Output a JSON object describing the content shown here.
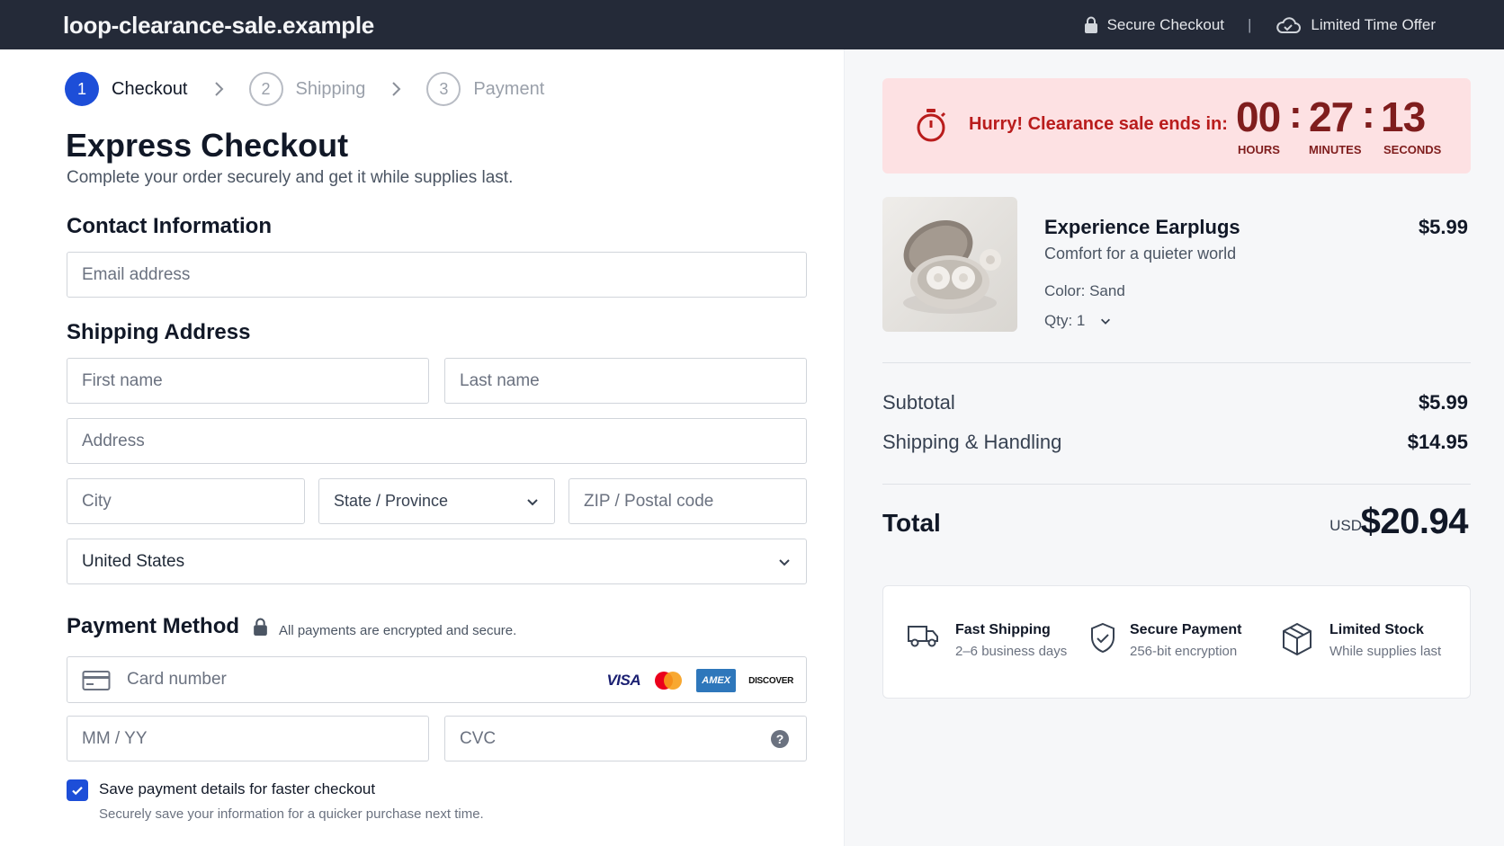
{
  "site_title": "loop-clearance-sale.example",
  "header": {
    "secure_checkout": "Secure Checkout",
    "separator": "|",
    "limited_offer": "Limited Time Offer"
  },
  "steps": [
    {
      "num": "1",
      "label": "Checkout"
    },
    {
      "num": "2",
      "label": "Shipping"
    },
    {
      "num": "3",
      "label": "Payment"
    }
  ],
  "page": {
    "title": "Express Checkout",
    "subtitle": "Complete your order securely and get it while supplies last."
  },
  "contact": {
    "heading": "Contact Information",
    "email_placeholder": "Email address"
  },
  "shipping": {
    "heading": "Shipping Address",
    "first_name": "First name",
    "last_name": "Last name",
    "address": "Address",
    "city": "City",
    "state": "State / Province",
    "zip": "ZIP / Postal code",
    "country": "United States"
  },
  "payment": {
    "heading": "Payment Method",
    "note": "All payments are encrypted and secure.",
    "card_number": "Card number",
    "card_brands": [
      "VISA",
      "AMEX",
      "DISCOVER"
    ],
    "expiry": "MM / YY",
    "cvc": "CVC",
    "save_label": "Save payment details for faster checkout",
    "save_sub": "Securely save your information for a quicker purchase next time.",
    "save_checked": true
  },
  "timer": {
    "hurry": "Hurry!",
    "message": "Clearance sale ends in:",
    "hours": "00",
    "minutes": "27",
    "seconds": "13",
    "colon": ":",
    "hours_label": "HOURS",
    "minutes_label": "MINUTES",
    "seconds_label": "SECONDS"
  },
  "product": {
    "name": "Experience Earplugs",
    "price": "$5.99",
    "description": "Comfort for a quieter world",
    "color": "Color: Sand",
    "qty": "Qty: 1"
  },
  "summary": {
    "subtotal_label": "Subtotal",
    "subtotal": "$5.99",
    "shipping_label": "Shipping & Handling",
    "shipping": "$14.95",
    "total_label": "Total",
    "currency": "USD",
    "total": "$20.94"
  },
  "trust": [
    {
      "title": "Fast Shipping",
      "sub": "2–6 business days",
      "icon": "truck-icon"
    },
    {
      "title": "Secure Payment",
      "sub": "256-bit encryption",
      "icon": "shield-check-icon"
    },
    {
      "title": "Limited Stock",
      "sub": "While supplies last",
      "icon": "box-icon"
    }
  ],
  "colors": {
    "accent": "#1d4ed8",
    "header_bg": "#242a38",
    "timer_bg": "#fde1e3",
    "timer_text": "#b91c1c"
  }
}
